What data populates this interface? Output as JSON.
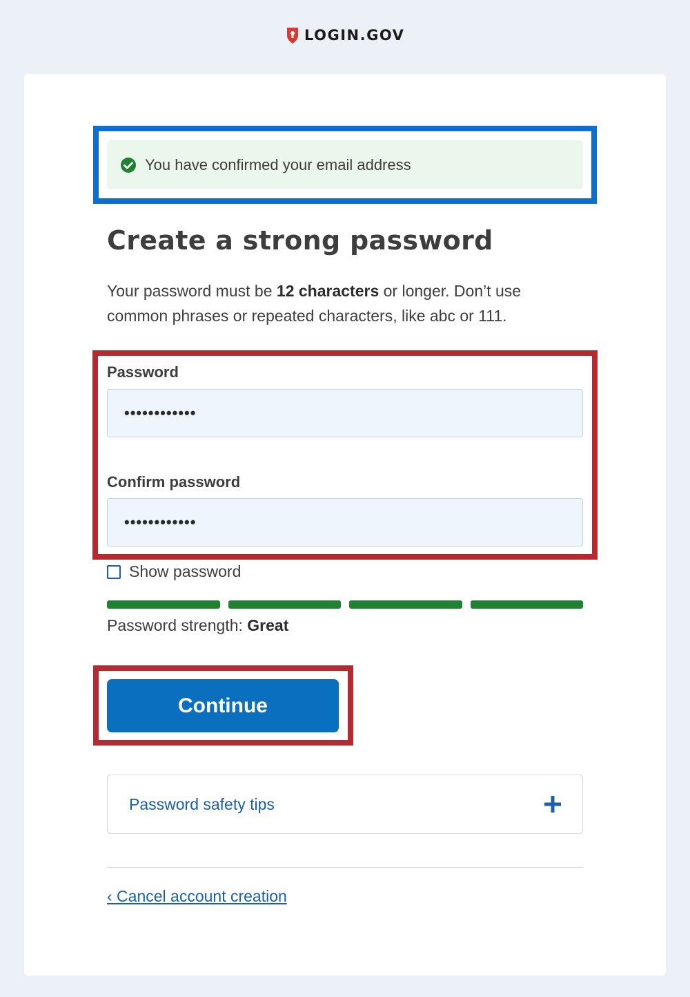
{
  "header": {
    "logo_text": "LOGIN.GOV"
  },
  "alert": {
    "message": "You have confirmed your email address",
    "icon": "check-circle-icon"
  },
  "main": {
    "heading": "Create a strong password",
    "intro_before": "Your password must be ",
    "intro_bold": "12 characters",
    "intro_after": " or longer. Don’t use common phrases or repeated characters, like abc or 111."
  },
  "form": {
    "password_label": "Password",
    "password_value": "••••••••••••",
    "confirm_label": "Confirm password",
    "confirm_value": "••••••••••••",
    "show_password_label": "Show password",
    "show_password_checked": false,
    "strength_label": "Password strength: ",
    "strength_value": "Great",
    "strength_level": 4,
    "strength_max": 4,
    "continue_label": "Continue"
  },
  "accordion": {
    "label": "Password safety tips",
    "icon": "plus-icon"
  },
  "footer": {
    "cancel_link": "‹ Cancel account creation"
  },
  "colors": {
    "brand_red": "#d83933",
    "primary_blue": "#0a6fbf",
    "success_green": "#1f8230",
    "highlight_blue": "#0b6ed0",
    "highlight_red": "#b32b31"
  }
}
